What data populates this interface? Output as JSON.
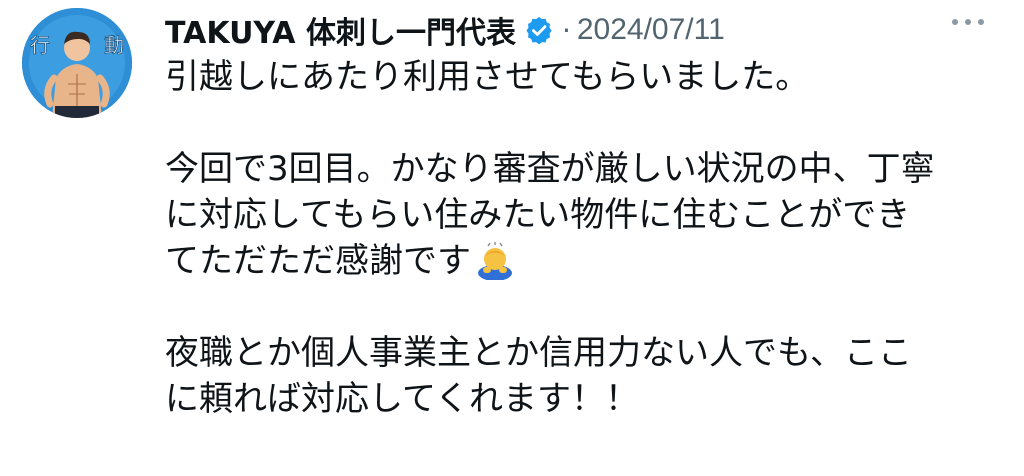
{
  "post": {
    "author_name": "TAKUYA 体刺し一門代表",
    "separator": "·",
    "date": "2024/07/11",
    "avatar_text": "行動",
    "body": {
      "p1_l1": "引越しにあたり利用させてもらいました。",
      "p2_l1": "今回で3回目。かなり審査が厳しい状況の中、丁寧",
      "p2_l2": "に対応してもらい住みたい物件に住むことができ",
      "p2_l3": "てただただ感謝です",
      "p3_l1": "夜職とか個人事業主とか信用力ない人でも、ここ",
      "p3_l2": "に頼れば対応してくれます！！"
    }
  },
  "icons": {
    "verified": "verified-badge-icon",
    "more": "more-options-icon",
    "bow_emoji": "person-bowing-emoji"
  },
  "colors": {
    "text": "#0f1419",
    "secondary": "#536471",
    "verified_blue": "#1d9bf0",
    "avatar_bg": "#2e8fd6"
  }
}
